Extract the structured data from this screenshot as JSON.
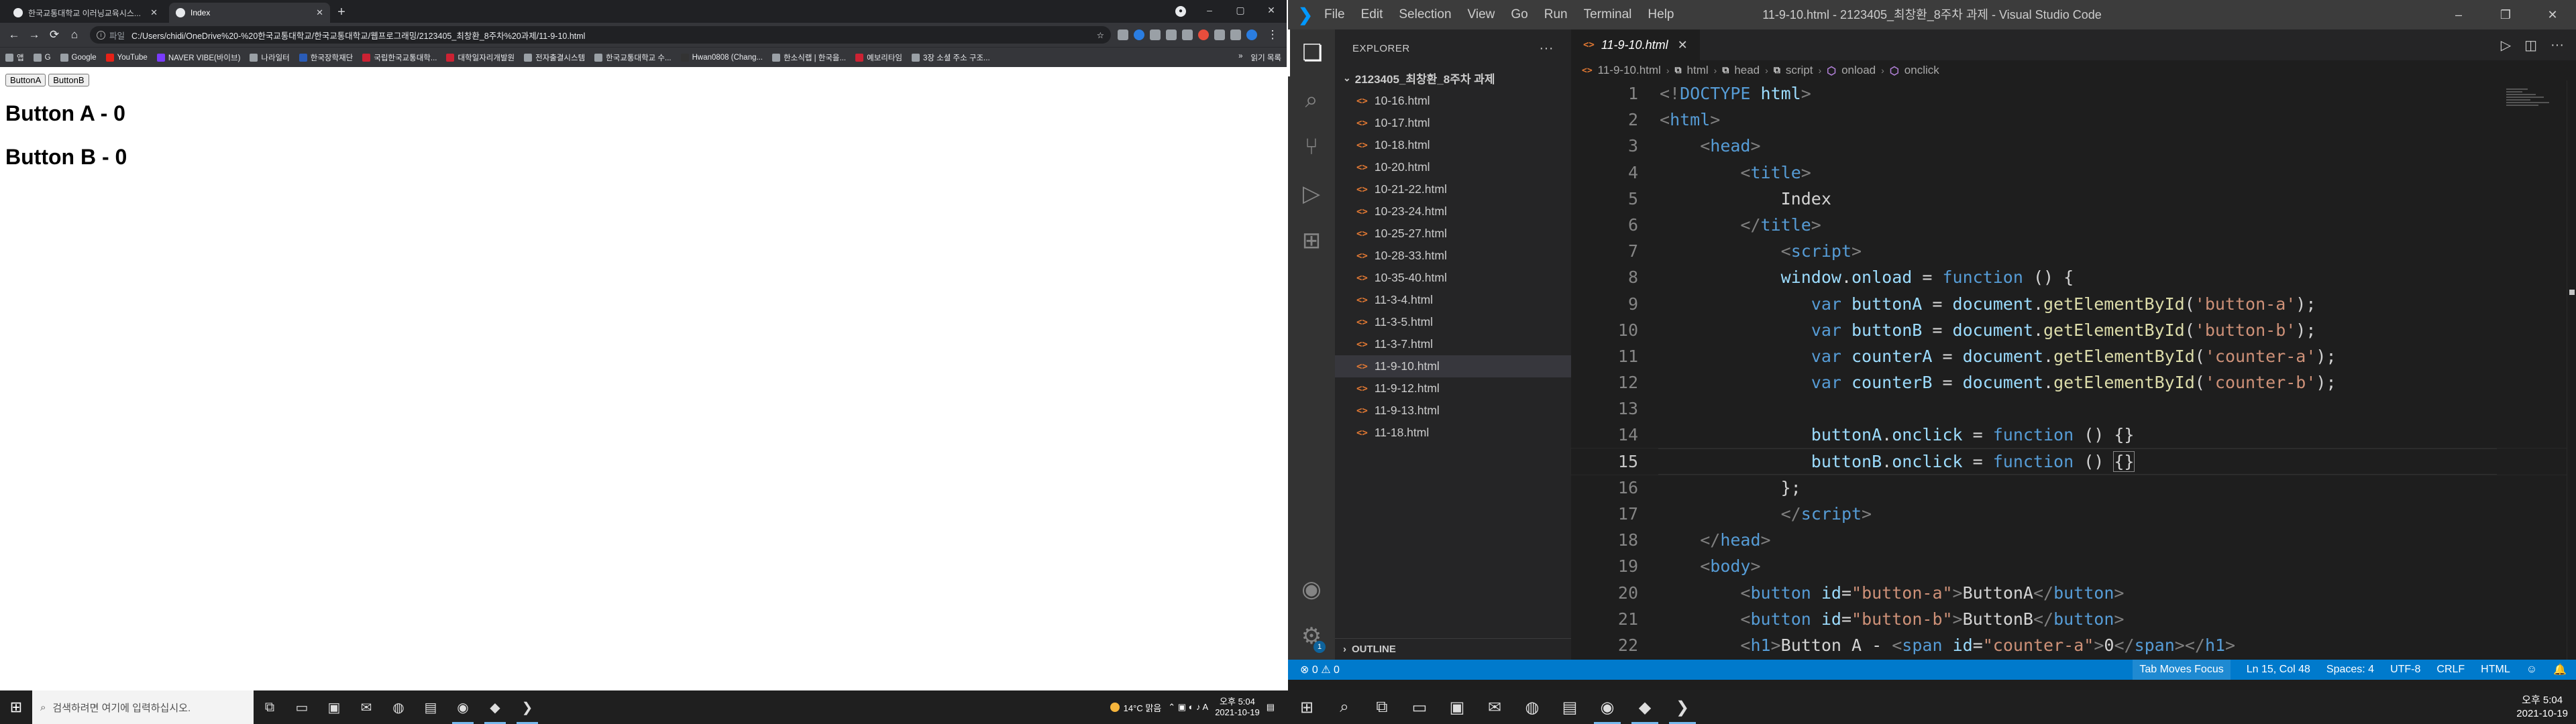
{
  "chrome": {
    "tabs": [
      {
        "label": "한국교통대학교 이러닝교육시스..."
      },
      {
        "label": "Index"
      }
    ],
    "new_tab": "+",
    "window_controls": {
      "minimize": "–",
      "maximize": "▢",
      "close": "✕"
    },
    "nav": {
      "back": "←",
      "forward": "→",
      "reload": "⟳",
      "home": "⌂"
    },
    "address": {
      "file_label": "파일",
      "url": "C:/Users/chidi/OneDrive%20-%20한국교통대학교/한국교통대학교/웹프로그래밍/2123405_최창환_8주차%20과제/11-9-10.html"
    },
    "bookmarks": [
      "앱",
      "G",
      "Google",
      "YouTube",
      "NAVER VIBE(바이브)",
      "나라일터",
      "한국장학재단",
      "국립한국교통대학...",
      "대학일자리개발원",
      "전자출결시스템",
      "한국교통대학교 수...",
      "Hwan0808 (Chang...",
      "한소식랩 | 한국을...",
      "예보리타임",
      "3장 소셜 주소 구조..."
    ],
    "bookmarks_more": "»",
    "reading_list": "읽기 목록"
  },
  "page": {
    "buttons": [
      "ButtonA",
      "ButtonB"
    ],
    "headings": [
      "Button A - 0",
      "Button B - 0"
    ]
  },
  "vscode": {
    "menu": [
      "File",
      "Edit",
      "Selection",
      "View",
      "Go",
      "Run",
      "Terminal",
      "Help"
    ],
    "window_title": "11-9-10.html - 2123405_최창환_8주차 과제 - Visual Studio Code",
    "explorer": {
      "header": "EXPLORER",
      "folder": "2123405_최창환_8주차 과제",
      "files": [
        "10-16.html",
        "10-17.html",
        "10-18.html",
        "10-20.html",
        "10-21-22.html",
        "10-23-24.html",
        "10-25-27.html",
        "10-28-33.html",
        "10-35-40.html",
        "11-3-4.html",
        "11-3-5.html",
        "11-3-7.html",
        "11-9-10.html",
        "11-9-12.html",
        "11-9-13.html",
        "11-18.html"
      ],
      "selected_index": 12,
      "outline": "OUTLINE"
    },
    "editor_tab": "11-9-10.html",
    "breadcrumb": [
      "11-9-10.html",
      "html",
      "head",
      "script",
      "onload",
      "onclick"
    ],
    "line_numbers": [
      "1",
      "2",
      "3",
      "4",
      "5",
      "6",
      "7",
      "8",
      "9",
      "10",
      "11",
      "12",
      "13",
      "14",
      "15",
      "16",
      "17",
      "18",
      "19",
      "20",
      "21",
      "22"
    ],
    "current_line": 15,
    "activity_badge": "1",
    "status": {
      "errors": "0",
      "warnings": "0",
      "tab_moves_focus": "Tab Moves Focus",
      "position": "Ln 15, Col 48",
      "spaces": "Spaces: 4",
      "encoding": "UTF-8",
      "eol": "CRLF",
      "language": "HTML"
    }
  },
  "taskbar": {
    "search_placeholder": "검색하려면 여기에 입력하십시오.",
    "weather": "14°C 맑음",
    "time": "오후 5:04",
    "date": "2021-10-19"
  },
  "colors": {
    "vscode_statusbar": "#007acc",
    "chrome_frame": "#202124",
    "html_file_icon": "#e37933"
  }
}
